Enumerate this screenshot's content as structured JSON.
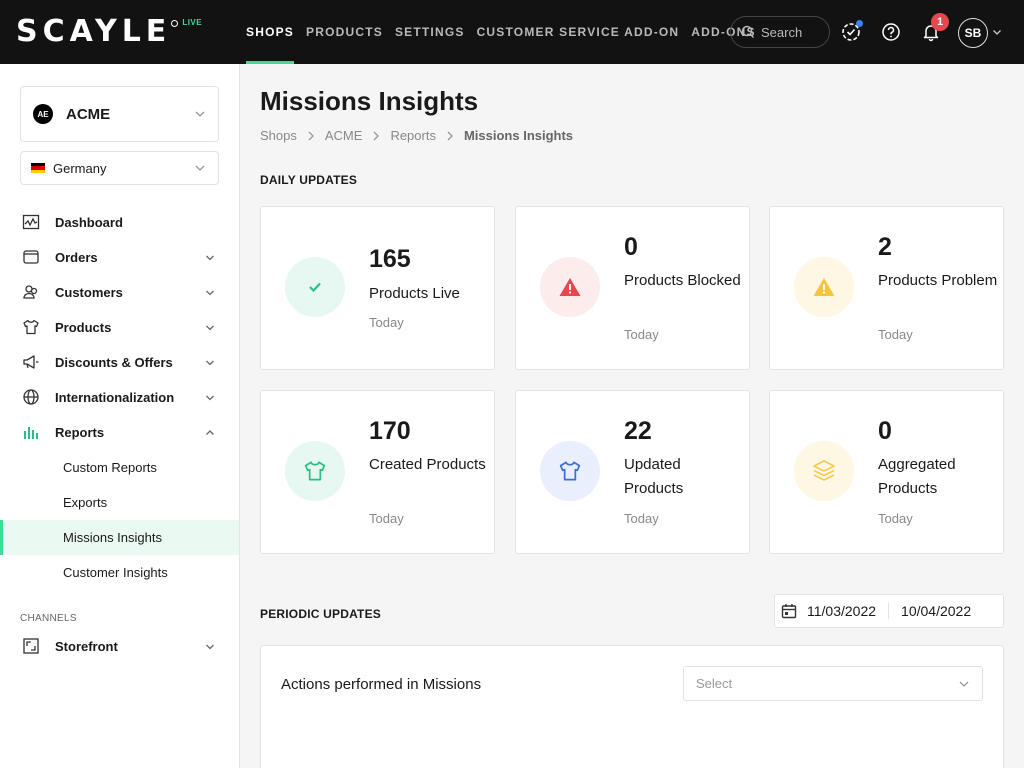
{
  "app": {
    "logo": "SCAYLE",
    "live_badge": "LIVE"
  },
  "topnav": {
    "items": [
      {
        "label": "SHOPS",
        "active": true
      },
      {
        "label": "PRODUCTS"
      },
      {
        "label": "SETTINGS"
      },
      {
        "label": "CUSTOMER SERVICE ADD-ON"
      },
      {
        "label": "ADD-ONS"
      }
    ],
    "search_placeholder": "Search",
    "notifications_count": "1",
    "avatar_initials": "SB"
  },
  "sidebar": {
    "shop": {
      "initials": "AE",
      "name": "ACME"
    },
    "country": "Germany",
    "items": [
      {
        "label": "Dashboard",
        "icon": "chart-line-icon"
      },
      {
        "label": "Orders",
        "icon": "cart-icon"
      },
      {
        "label": "Customers",
        "icon": "users-icon"
      },
      {
        "label": "Products",
        "icon": "shirt-icon"
      },
      {
        "label": "Discounts & Offers",
        "icon": "megaphone-icon"
      },
      {
        "label": "Internationalization",
        "icon": "globe-icon"
      },
      {
        "label": "Reports",
        "icon": "bar-chart-icon"
      }
    ],
    "report_subitems": [
      "Custom Reports",
      "Exports",
      "Missions Insights",
      "Customer Insights"
    ],
    "channels_label": "CHANNELS",
    "storefront": "Storefront"
  },
  "main": {
    "title": "Missions Insights",
    "breadcrumb": [
      "Shops",
      "ACME",
      "Reports",
      "Missions Insights"
    ],
    "daily_label": "DAILY UPDATES",
    "cards": [
      {
        "value": "165",
        "label": "Products Live",
        "sub": "Today",
        "icon": "check-icon",
        "tint": "#e6f8f1",
        "color": "#2bbf85"
      },
      {
        "value": "0",
        "label": "Products Blocked",
        "sub": "Today",
        "icon": "alert-red-icon",
        "tint": "#fdecec",
        "color": "#e5484d"
      },
      {
        "value": "2",
        "label": "Products Problem",
        "sub": "Today",
        "icon": "warning-yellow-icon",
        "tint": "#fdf7e4",
        "color": "#f5c53c"
      },
      {
        "value": "170",
        "label": "Created Products",
        "sub": "Today",
        "icon": "shirt-green-icon",
        "tint": "#e6f8f1",
        "color": "#2bbf85"
      },
      {
        "value": "22",
        "label": "Updated Products",
        "sub": "Today",
        "icon": "shirt-blue-icon",
        "tint": "#e9effc",
        "color": "#3a6fd8"
      },
      {
        "value": "0",
        "label": "Aggregated Products",
        "sub": "Today",
        "icon": "layers-icon",
        "tint": "#fdf7e4",
        "color": "#f5c53c"
      }
    ],
    "periodic_label": "PERIODIC UPDATES",
    "date_from": "11/03/2022",
    "date_to": "10/04/2022",
    "panel_title": "Actions performed in Missions",
    "panel_select_placeholder": "Select"
  }
}
